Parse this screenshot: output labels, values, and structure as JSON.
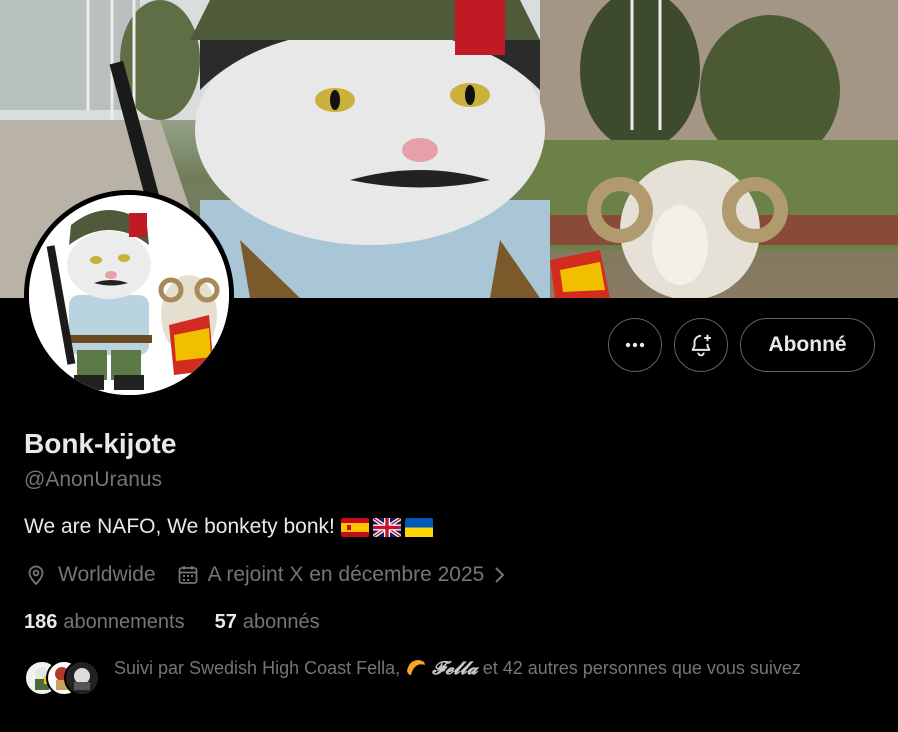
{
  "profile": {
    "display_name": "Bonk-kijote",
    "handle": "@AnonUranus",
    "bio_text": "We are NAFO, We bonkety bonk!",
    "bio_flags": [
      "flag-spain-icon",
      "flag-uk-icon",
      "flag-ukraine-icon"
    ],
    "location": "Worldwide",
    "joined": "A rejoint X en décembre 2025"
  },
  "actions": {
    "more_icon": "ellipsis-icon",
    "notify_icon": "bell-plus-icon",
    "follow_label": "Abonné"
  },
  "stats": {
    "following_count": "186",
    "following_label": "abonnements",
    "followers_count": "57",
    "followers_label": "abonnés"
  },
  "followed_by": {
    "prefix": "Suivi par Swedish High Coast Fella,",
    "fella_name": "𝓕𝓮𝓵𝓵𝓪",
    "suffix": "et 42 autres personnes que vous suivez"
  },
  "colors": {
    "background": "#000000",
    "primary_text": "#e7e9ea",
    "secondary_text": "#71767b",
    "border": "#536471"
  }
}
